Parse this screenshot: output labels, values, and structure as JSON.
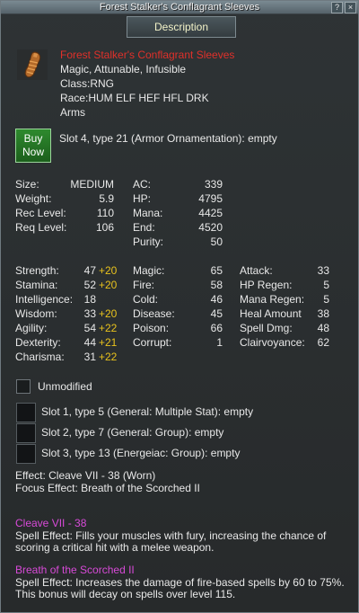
{
  "window": {
    "title": "Forest Stalker's Conflagrant Sleeves",
    "help_button": "?",
    "close_button": "×"
  },
  "tab": {
    "label": "Description"
  },
  "item": {
    "name": "Forest Stalker's Conflagrant Sleeves",
    "flags": "Magic, Attunable, Infusible",
    "class_line": "Class:RNG",
    "race_line": "Race:HUM ELF HEF HFL DRK",
    "slot_line": "Arms",
    "icon": "sleeve-armor-icon"
  },
  "buy": {
    "label_top": "Buy",
    "label_bottom": "Now"
  },
  "ornament": {
    "text": "Slot 4, type 21 (Armor Ornamentation): empty"
  },
  "stats_basic": [
    {
      "label": "Size:",
      "value": "MEDIUM"
    },
    {
      "label": "Weight:",
      "value": "5.9"
    },
    {
      "label": "Rec Level:",
      "value": "110"
    },
    {
      "label": "Req Level:",
      "value": "106"
    }
  ],
  "stats_def": [
    {
      "label": "AC:",
      "value": "339"
    },
    {
      "label": "HP:",
      "value": "4795"
    },
    {
      "label": "Mana:",
      "value": "4425"
    },
    {
      "label": "End:",
      "value": "4520"
    },
    {
      "label": "Purity:",
      "value": "50"
    }
  ],
  "attributes": [
    {
      "label": "Strength:",
      "value": "47",
      "bonus": "+20"
    },
    {
      "label": "Stamina:",
      "value": "52",
      "bonus": "+20"
    },
    {
      "label": "Intelligence:",
      "value": "18",
      "bonus": ""
    },
    {
      "label": "Wisdom:",
      "value": "33",
      "bonus": "+20"
    },
    {
      "label": "Agility:",
      "value": "54",
      "bonus": "+22"
    },
    {
      "label": "Dexterity:",
      "value": "44",
      "bonus": "+21"
    },
    {
      "label": "Charisma:",
      "value": "31",
      "bonus": "+22"
    }
  ],
  "resists": [
    {
      "label": "Magic:",
      "value": "65"
    },
    {
      "label": "Fire:",
      "value": "58"
    },
    {
      "label": "Cold:",
      "value": "46"
    },
    {
      "label": "Disease:",
      "value": "45"
    },
    {
      "label": "Poison:",
      "value": "66"
    },
    {
      "label": "Corrupt:",
      "value": "1"
    }
  ],
  "mods": [
    {
      "label": "Attack:",
      "value": "33"
    },
    {
      "label": "HP Regen:",
      "value": "5"
    },
    {
      "label": "Mana Regen:",
      "value": "5"
    },
    {
      "label": "Heal Amount",
      "value": "38"
    },
    {
      "label": "Spell Dmg:",
      "value": "48"
    },
    {
      "label": "Clairvoyance:",
      "value": "62"
    }
  ],
  "unmodified": {
    "label": "Unmodified"
  },
  "aug_slots": [
    {
      "text": "Slot 1, type 5 (General: Multiple Stat): empty"
    },
    {
      "text": "Slot 2, type 7 (General: Group): empty"
    },
    {
      "text": "Slot 3, type 13 (Energeiac: Group): empty"
    }
  ],
  "effects": {
    "effect": "Effect: Cleave VII - 38 (Worn)",
    "focus": "Focus Effect: Breath of the Scorched II"
  },
  "spell1": {
    "title": "Cleave VII - 38",
    "line1": "Spell Effect: Fills your muscles with fury, increasing the chance of",
    "line2": "scoring a critical hit with a melee weapon."
  },
  "spell2": {
    "title": "Breath of the Scorched II",
    "line1": "Spell Effect: Increases the damage of fire-based spells by 60 to 75%.",
    "line2": "This bonus will decay on spells over level 115."
  }
}
